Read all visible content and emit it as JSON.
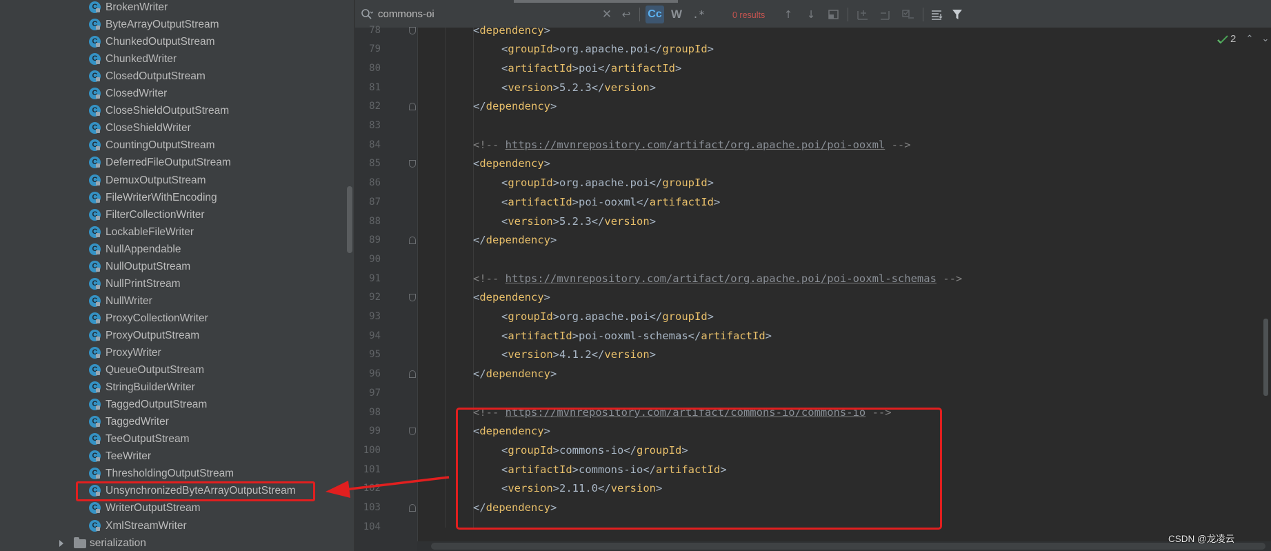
{
  "project_tree": {
    "items": [
      {
        "label": "BrokenWriter",
        "kind": "class"
      },
      {
        "label": "ByteArrayOutputStream",
        "kind": "class"
      },
      {
        "label": "ChunkedOutputStream",
        "kind": "class"
      },
      {
        "label": "ChunkedWriter",
        "kind": "class"
      },
      {
        "label": "ClosedOutputStream",
        "kind": "class"
      },
      {
        "label": "ClosedWriter",
        "kind": "class"
      },
      {
        "label": "CloseShieldOutputStream",
        "kind": "class"
      },
      {
        "label": "CloseShieldWriter",
        "kind": "class"
      },
      {
        "label": "CountingOutputStream",
        "kind": "class"
      },
      {
        "label": "DeferredFileOutputStream",
        "kind": "class"
      },
      {
        "label": "DemuxOutputStream",
        "kind": "class"
      },
      {
        "label": "FileWriterWithEncoding",
        "kind": "class"
      },
      {
        "label": "FilterCollectionWriter",
        "kind": "class"
      },
      {
        "label": "LockableFileWriter",
        "kind": "class"
      },
      {
        "label": "NullAppendable",
        "kind": "class"
      },
      {
        "label": "NullOutputStream",
        "kind": "class"
      },
      {
        "label": "NullPrintStream",
        "kind": "class"
      },
      {
        "label": "NullWriter",
        "kind": "class"
      },
      {
        "label": "ProxyCollectionWriter",
        "kind": "class"
      },
      {
        "label": "ProxyOutputStream",
        "kind": "class"
      },
      {
        "label": "ProxyWriter",
        "kind": "class"
      },
      {
        "label": "QueueOutputStream",
        "kind": "class"
      },
      {
        "label": "StringBuilderWriter",
        "kind": "class"
      },
      {
        "label": "TaggedOutputStream",
        "kind": "class"
      },
      {
        "label": "TaggedWriter",
        "kind": "class"
      },
      {
        "label": "TeeOutputStream",
        "kind": "class"
      },
      {
        "label": "TeeWriter",
        "kind": "class"
      },
      {
        "label": "ThresholdingOutputStream",
        "kind": "class"
      },
      {
        "label": "UnsynchronizedByteArrayOutputStream",
        "kind": "class",
        "highlighted": true
      },
      {
        "label": "WriterOutputStream",
        "kind": "class"
      },
      {
        "label": "XmlStreamWriter",
        "kind": "class"
      },
      {
        "label": "serialization",
        "kind": "folder"
      }
    ]
  },
  "search": {
    "query": "commons-oi",
    "results_label": "0 results",
    "match_case_label": "Cc",
    "words_label": "W",
    "regex_label": ".*"
  },
  "editor": {
    "inspection_count": "2",
    "lines": [
      {
        "num": "78",
        "indent": 1,
        "tokens": [
          [
            "br",
            "<"
          ],
          [
            "tag",
            "dependency"
          ],
          [
            "br",
            ">"
          ]
        ]
      },
      {
        "num": "79",
        "indent": 2,
        "tokens": [
          [
            "br",
            "<"
          ],
          [
            "tag",
            "groupId"
          ],
          [
            "br",
            ">"
          ],
          [
            "txt",
            "org.apache.poi"
          ],
          [
            "br",
            "</"
          ],
          [
            "tag",
            "groupId"
          ],
          [
            "br",
            ">"
          ]
        ]
      },
      {
        "num": "80",
        "indent": 2,
        "tokens": [
          [
            "br",
            "<"
          ],
          [
            "tag",
            "artifactId"
          ],
          [
            "br",
            ">"
          ],
          [
            "txt",
            "poi"
          ],
          [
            "br",
            "</"
          ],
          [
            "tag",
            "artifactId"
          ],
          [
            "br",
            ">"
          ]
        ]
      },
      {
        "num": "81",
        "indent": 2,
        "tokens": [
          [
            "br",
            "<"
          ],
          [
            "tag",
            "version"
          ],
          [
            "br",
            ">"
          ],
          [
            "txt",
            "5.2.3"
          ],
          [
            "br",
            "</"
          ],
          [
            "tag",
            "version"
          ],
          [
            "br",
            ">"
          ]
        ]
      },
      {
        "num": "82",
        "indent": 1,
        "tokens": [
          [
            "br",
            "</"
          ],
          [
            "tag",
            "dependency"
          ],
          [
            "br",
            ">"
          ]
        ]
      },
      {
        "num": "83",
        "indent": 0,
        "tokens": []
      },
      {
        "num": "84",
        "indent": 1,
        "tokens": [
          [
            "comment",
            "<!-- "
          ],
          [
            "link",
            "https://mvnrepository.com/artifact/org.apache.poi/poi-ooxml"
          ],
          [
            "comment",
            " -->"
          ]
        ]
      },
      {
        "num": "85",
        "indent": 1,
        "tokens": [
          [
            "br",
            "<"
          ],
          [
            "tag",
            "dependency"
          ],
          [
            "br",
            ">"
          ]
        ]
      },
      {
        "num": "86",
        "indent": 2,
        "tokens": [
          [
            "br",
            "<"
          ],
          [
            "tag",
            "groupId"
          ],
          [
            "br",
            ">"
          ],
          [
            "txt",
            "org.apache.poi"
          ],
          [
            "br",
            "</"
          ],
          [
            "tag",
            "groupId"
          ],
          [
            "br",
            ">"
          ]
        ]
      },
      {
        "num": "87",
        "indent": 2,
        "tokens": [
          [
            "br",
            "<"
          ],
          [
            "tag",
            "artifactId"
          ],
          [
            "br",
            ">"
          ],
          [
            "txt",
            "poi-ooxml"
          ],
          [
            "br",
            "</"
          ],
          [
            "tag",
            "artifactId"
          ],
          [
            "br",
            ">"
          ]
        ]
      },
      {
        "num": "88",
        "indent": 2,
        "tokens": [
          [
            "br",
            "<"
          ],
          [
            "tag",
            "version"
          ],
          [
            "br",
            ">"
          ],
          [
            "txt",
            "5.2.3"
          ],
          [
            "br",
            "</"
          ],
          [
            "tag",
            "version"
          ],
          [
            "br",
            ">"
          ]
        ]
      },
      {
        "num": "89",
        "indent": 1,
        "tokens": [
          [
            "br",
            "</"
          ],
          [
            "tag",
            "dependency"
          ],
          [
            "br",
            ">"
          ]
        ]
      },
      {
        "num": "90",
        "indent": 0,
        "tokens": []
      },
      {
        "num": "91",
        "indent": 1,
        "tokens": [
          [
            "comment",
            "<!-- "
          ],
          [
            "link",
            "https://mvnrepository.com/artifact/org.apache.poi/poi-ooxml-schemas"
          ],
          [
            "comment",
            " -->"
          ]
        ]
      },
      {
        "num": "92",
        "indent": 1,
        "tokens": [
          [
            "br",
            "<"
          ],
          [
            "tag",
            "dependency"
          ],
          [
            "br",
            ">"
          ]
        ]
      },
      {
        "num": "93",
        "indent": 2,
        "tokens": [
          [
            "br",
            "<"
          ],
          [
            "tag",
            "groupId"
          ],
          [
            "br",
            ">"
          ],
          [
            "txt",
            "org.apache.poi"
          ],
          [
            "br",
            "</"
          ],
          [
            "tag",
            "groupId"
          ],
          [
            "br",
            ">"
          ]
        ]
      },
      {
        "num": "94",
        "indent": 2,
        "tokens": [
          [
            "br",
            "<"
          ],
          [
            "tag",
            "artifactId"
          ],
          [
            "br",
            ">"
          ],
          [
            "txt",
            "poi-ooxml-schemas"
          ],
          [
            "br",
            "</"
          ],
          [
            "tag",
            "artifactId"
          ],
          [
            "br",
            ">"
          ]
        ]
      },
      {
        "num": "95",
        "indent": 2,
        "tokens": [
          [
            "br",
            "<"
          ],
          [
            "tag",
            "version"
          ],
          [
            "br",
            ">"
          ],
          [
            "txt",
            "4.1.2"
          ],
          [
            "br",
            "</"
          ],
          [
            "tag",
            "version"
          ],
          [
            "br",
            ">"
          ]
        ]
      },
      {
        "num": "96",
        "indent": 1,
        "tokens": [
          [
            "br",
            "</"
          ],
          [
            "tag",
            "dependency"
          ],
          [
            "br",
            ">"
          ]
        ]
      },
      {
        "num": "97",
        "indent": 0,
        "tokens": []
      },
      {
        "num": "98",
        "indent": 1,
        "tokens": [
          [
            "comment",
            "<!-- "
          ],
          [
            "link",
            "https://mvnrepository.com/artifact/commons-io/commons-io"
          ],
          [
            "comment",
            " -->"
          ]
        ]
      },
      {
        "num": "99",
        "indent": 1,
        "tokens": [
          [
            "br",
            "<"
          ],
          [
            "tag",
            "dependency"
          ],
          [
            "br",
            ">"
          ]
        ]
      },
      {
        "num": "100",
        "indent": 2,
        "tokens": [
          [
            "br",
            "<"
          ],
          [
            "tag",
            "groupId"
          ],
          [
            "br",
            ">"
          ],
          [
            "txt",
            "commons-io"
          ],
          [
            "br",
            "</"
          ],
          [
            "tag",
            "groupId"
          ],
          [
            "br",
            ">"
          ]
        ]
      },
      {
        "num": "101",
        "indent": 2,
        "tokens": [
          [
            "br",
            "<"
          ],
          [
            "tag",
            "artifactId"
          ],
          [
            "br",
            ">"
          ],
          [
            "txt",
            "commons-io"
          ],
          [
            "br",
            "</"
          ],
          [
            "tag",
            "artifactId"
          ],
          [
            "br",
            ">"
          ]
        ]
      },
      {
        "num": "102",
        "indent": 2,
        "tokens": [
          [
            "br",
            "<"
          ],
          [
            "tag",
            "version"
          ],
          [
            "br",
            ">"
          ],
          [
            "txt",
            "2.11.0"
          ],
          [
            "br",
            "</"
          ],
          [
            "tag",
            "version"
          ],
          [
            "br",
            ">"
          ]
        ]
      },
      {
        "num": "103",
        "indent": 1,
        "tokens": [
          [
            "br",
            "</"
          ],
          [
            "tag",
            "dependency"
          ],
          [
            "br",
            ">"
          ]
        ]
      },
      {
        "num": "104",
        "indent": 0,
        "tokens": []
      }
    ]
  },
  "watermark": "CSDN @龙凌云",
  "colors": {
    "annotation_red": "#e11f1f",
    "xml_tag": "#e8bf6a",
    "xml_text": "#a9b7c6",
    "comment": "#808080",
    "results_none": "#c75450",
    "class_icon": "#3592c4"
  }
}
